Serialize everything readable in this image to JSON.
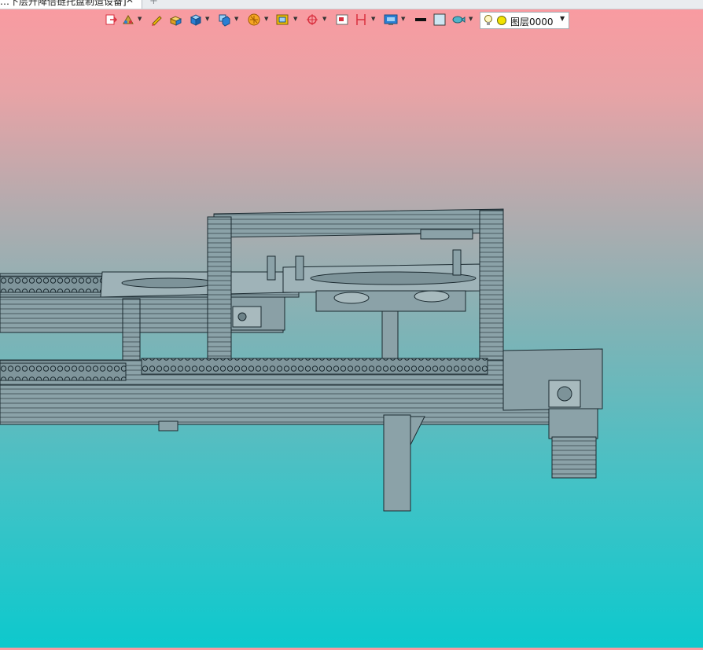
{
  "tab": {
    "title": "…下层升降倍链托盘制造设备]",
    "close_glyph": "✕",
    "new_tab_glyph": "+"
  },
  "toolbar": {
    "icons": [
      "exit-icon",
      "material-palette-icon",
      "pencil-edit-icon",
      "solid-box-icon",
      "cube-render-icon",
      "view-orientation-icon",
      "section-view-icon",
      "display-style-icon",
      "snap-target-icon",
      "window-frame-icon",
      "dimension-icon",
      "screen-view-icon",
      "line-weight-icon",
      "fill-color-icon",
      "fish-style-icon",
      "lightbulb-icon",
      "layer-color-icon"
    ],
    "colors": {
      "accent_red": "#d9303f",
      "accent_blue": "#2a7fd4",
      "accent_yellow": "#f2c200",
      "accent_orange": "#f08a1c"
    }
  },
  "layer": {
    "name": "图层0000"
  },
  "viewport": {
    "background_top": "#fb9aa0",
    "background_bottom": "#0dc9cd",
    "model_color": "#8fa4aa",
    "edge_color": "#1b2a30"
  }
}
